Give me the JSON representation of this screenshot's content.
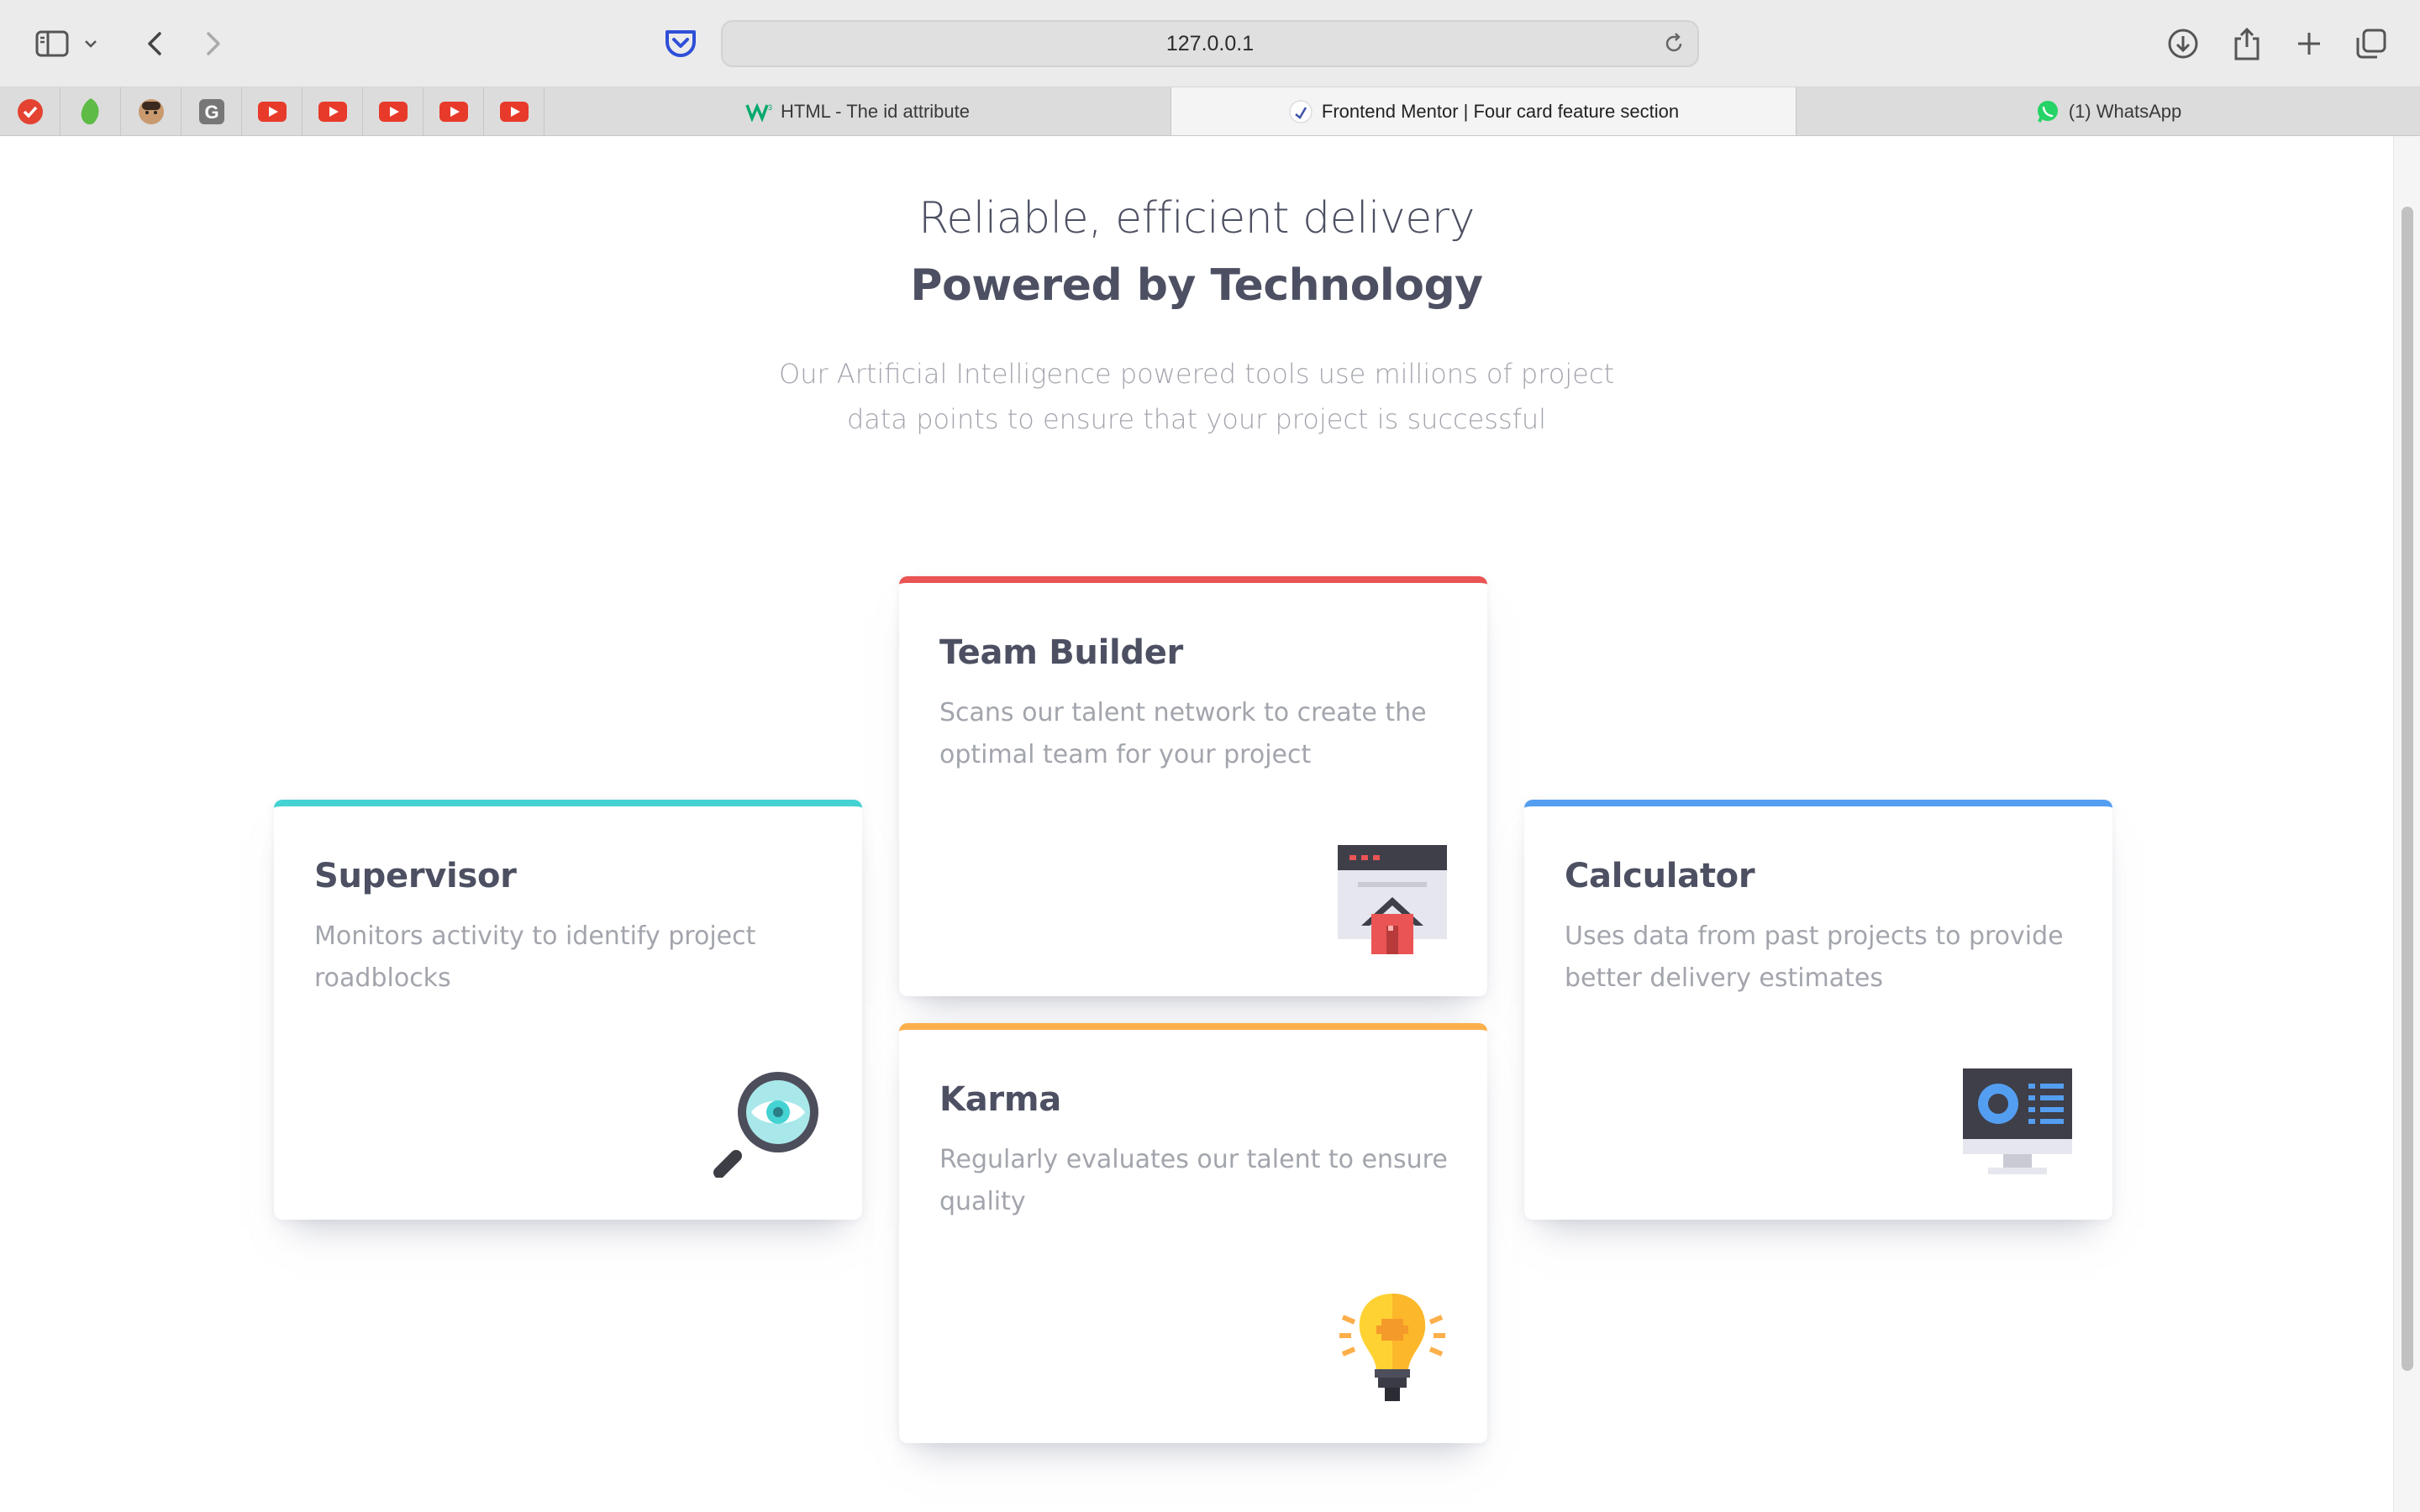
{
  "browser": {
    "url": "127.0.0.1",
    "tabs": [
      {
        "label": "HTML - The id attribute",
        "icon": "w3schools-icon",
        "active": false
      },
      {
        "label": "Frontend Mentor | Four card feature section",
        "icon": "frontend-mentor-icon",
        "active": true
      },
      {
        "label": "(1) WhatsApp",
        "icon": "whatsapp-icon",
        "active": false
      }
    ],
    "pinned_tabs": [
      "todoist-icon",
      "evernote-icon",
      "avatar-icon",
      "g-icon",
      "youtube-icon",
      "youtube-icon",
      "youtube-icon",
      "youtube-icon",
      "youtube-icon"
    ]
  },
  "header": {
    "tagline": "Reliable, efficient delivery",
    "title": "Powered by Technology",
    "intro_line1": "Our Artificial Intelligence powered tools use millions of project",
    "intro_line2": "data points to ensure that your project is successful"
  },
  "cards": {
    "supervisor": {
      "title": "Supervisor",
      "line1": "Monitors activity to identify project",
      "line2": "roadblocks",
      "icon": "magnifier-eye-icon",
      "accent": "#44d3d2"
    },
    "team_builder": {
      "title": "Team Builder",
      "line1": "Scans our talent network to create the",
      "line2": "optimal team for your project",
      "icon": "team-builder-icon",
      "accent": "#ea5454"
    },
    "karma": {
      "title": "Karma",
      "line1": "Regularly evaluates our talent to ensure",
      "line2": "quality",
      "icon": "lightbulb-icon",
      "accent": "#fcaf4a"
    },
    "calculator": {
      "title": "Calculator",
      "line1": "Uses data from past projects to provide",
      "line2": "better delivery estimates",
      "icon": "calculator-monitor-icon",
      "accent": "#549ef2"
    }
  }
}
